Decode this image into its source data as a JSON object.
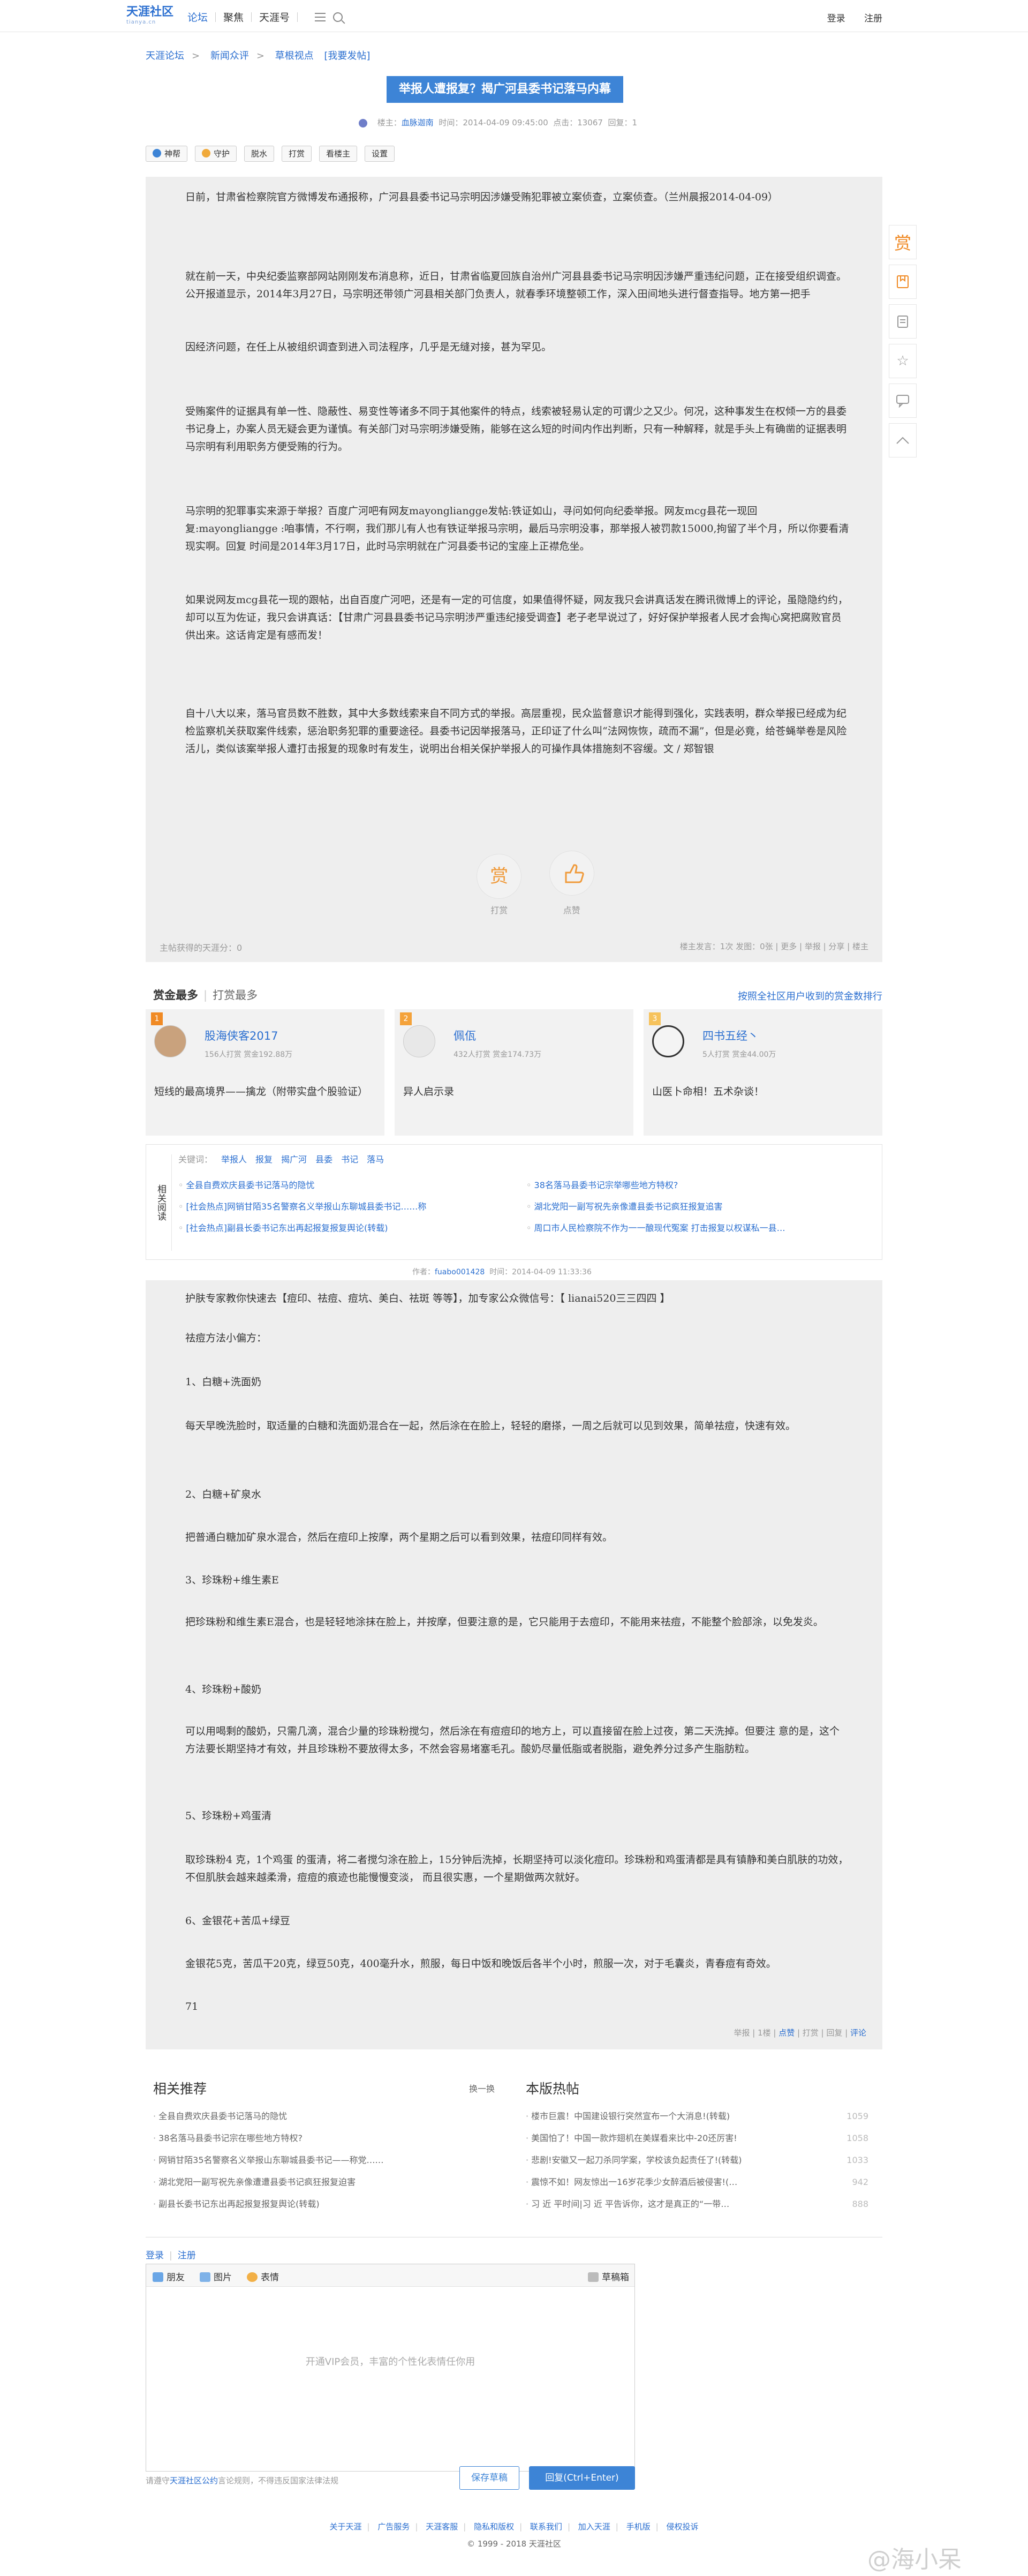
{
  "header": {
    "logo_text": "天涯社区",
    "logo_sub": "tianya.cn",
    "nav": [
      "论坛",
      "聚焦",
      "天涯号"
    ],
    "login": "登录",
    "register": "注册"
  },
  "breadcrumb": [
    "天涯论坛",
    "新闻众评",
    "草根视点",
    "[我要发帖]"
  ],
  "post": {
    "title": "举报人遭报复？揭广河县委书记落马内幕",
    "author_label": "楼主：",
    "author": "血脉迦南",
    "time": "时间：2014-04-09 09:45:00",
    "views": "点击：13067",
    "replies": "回复：1",
    "tools": [
      "神帮",
      "守护",
      "脱水",
      "打赏",
      "看楼主",
      "设置"
    ],
    "paragraphs": [
      "日前，甘肃省检察院官方微博发布通报称，广河县县委书记马宗明因涉嫌受贿犯罪被立案侦查，立案侦查。（兰州晨报2014-04-09）",
      "就在前一天，中央纪委监察部网站刚刚发布消息称，近日，甘肃省临夏回族自治州广河县县委书记马宗明因涉嫌严重违纪问题，正在接受组织调查。公开报道显示，2014年3月27日，马宗明还带领广河县相关部门负责人，就春季环境整顿工作，深入田间地头进行督查指导。地方第一把手",
      "因经济问题，在任上从被组织调查到进入司法程序，几乎是无缝对接，甚为罕见。",
      "受贿案件的证据具有单一性、隐蔽性、易变性等诸多不同于其他案件的特点，线索被轻易认定的可谓少之又少。何况，这种事发生在权倾一方的县委书记身上，办案人员无疑会更为谨慎。有关部门对马宗明涉嫌受贿，能够在这么短的时间内作出判断，只有一种解释，就是手头上有确凿的证据表明马宗明有利用职务方便受贿的行为。",
      "马宗明的犯罪事实来源于举报？百度广河吧有网友mayongliangge发帖:铁证如山，寻问如何向纪委举报。网友mcg县花一现回复:mayongliangge :咱事情，不行啊，我们那儿有人也有铁证举报马宗明，最后马宗明没事，那举报人被罚款15000,拘留了半个月，所以你要看清现实啊。回复 时间是2014年3月17日，此时马宗明就在广河县委书记的宝座上正襟危坐。",
      "如果说网友mcg县花一现的跟帖，出自百度广河吧，还是有一定的可信度，如果值得怀疑，网友我只会讲真话发在腾讯微博上的评论，虽隐隐约约，却可以互为佐证，我只会讲真话：【甘肃广河县县委书记马宗明涉严重违纪接受调查】老子老早说过了，好好保护举报者人民才会掏心窝把腐败官员供出来。这话肯定是有感而发！",
      "自十八大以来，落马官员数不胜数，其中大多数线索来自不同方式的举报。高层重视，民众监督意识才能得到强化，实践表明，群众举报已经成为纪检监察机关获取案件线索，惩治职务犯罪的重要途径。县委书记因举报落马，正印证了什么叫“法网恢恢，疏而不漏”，但是必竟，给苍蝇举卷是风险活儿，类似该案举报人遭打击报复的现象时有发生，说明出台相关保护举报人的可操作具体措施刻不容缓。文 / 郑智银"
    ],
    "reward_label": "打赏",
    "like_label": "点赞",
    "reward_score": "主帖获得的天涯分：0",
    "foot_actions": "楼主发言：1次  发图：0张 | 更多 | 举报 | 分享 | 楼主"
  },
  "sidebar_icons": [
    "赏",
    "收藏",
    "日历",
    "收藏星",
    "评论",
    "返回顶部"
  ],
  "rewards": {
    "tab_active": "赏金最多",
    "tab_other": "打赏最多",
    "rank_link": "按照全社区用户收到的赏金数排行",
    "cards": [
      {
        "rank": "1",
        "name": "股海侠客2017",
        "sub": "156人打赏  赏金192.88万",
        "desc": "短线的最高境界——擒龙（附带实盘个股验证）"
      },
      {
        "rank": "2",
        "name": "佩佤",
        "sub": "432人打赏  赏金174.73万",
        "desc": "异人启示录"
      },
      {
        "rank": "3",
        "name": "四书五经丶",
        "sub": "5人打赏  赏金44.00万",
        "desc": "山医卜命相！五术杂谈！"
      }
    ]
  },
  "related": {
    "label": "相关阅读",
    "keywords_label": "关键词：",
    "keywords": [
      "举报人",
      "报复",
      "揭广河",
      "县委",
      "书记",
      "落马"
    ],
    "left": [
      "全县自费欢庆县委书记落马的隐忧",
      "[社会热点]网销甘陌35名警察名义举报山东聊城县委书记……称",
      "[社会热点]副县长委书记东出再起报复报复舆论(转载)"
    ],
    "right": [
      "38名落马县委书记宗举哪些地方特权?",
      "湖北党阳一副写祝先亲像遭县委书记疯狂报复追害",
      "周口市人民检察院不作为一一酿现代冤案 打击报复以权谋私一县…"
    ]
  },
  "reply": {
    "author": "fuabo001428",
    "time": "时间：2014-04-09 11:33:36",
    "paragraphs": [
      "护肤专家教你快速去【痘印、祛痘、痘坑、美白、祛斑 等等】，加专家公众微信号：【 lianai520三三四四 】",
      "祛痘方法小偏方：",
      "1、白糖+洗面奶",
      "每天早晚洗脸时，取适量的白糖和洗面奶混合在一起，然后涂在在脸上，轻轻的磨搽，一周之后就可以见到效果，简单祛痘，快速有效。",
      "2、白糖+矿泉水",
      "把普通白糖加矿泉水混合，然后在痘印上按摩，两个星期之后可以看到效果，祛痘印同样有效。",
      "3、珍珠粉+维生素E",
      "把珍珠粉和维生素E混合，也是轻轻地涂抹在脸上，并按摩，但要注意的是，它只能用于去痘印，不能用来祛痘，不能整个脸部涂，以免发炎。",
      "4、珍珠粉+酸奶",
      "可以用喝剩的酸奶，只需几滴，混合少量的珍珠粉搅匀，然后涂在有痘痘印的地方上，可以直接留在脸上过夜，第二天洗掉。但要注 意的是，这个方法要长期坚持才有效，并且珍珠粉不要放得太多，不然会容易堵塞毛孔。酸奶尽量低脂或者脱脂，避免养分过多产生脂肪粒。",
      "5、珍珠粉+鸡蛋清",
      "取珍珠粉4 克，1个鸡蛋 的蛋清，将二者搅匀涂在脸上，15分钟后洗掉，长期坚持可以淡化痘印。珍珠粉和鸡蛋清都是具有镇静和美白肌肤的功效，不但肌肤会越来越柔滑，痘痘的痕迹也能慢慢变淡， 而且很实惠，一个星期做两次就好。",
      "6、金银花+苦瓜+绿豆",
      "金银花5克，苦瓜干20克，绿豆50克，400毫升水，煎服，每日中饭和晚饭后各半个小时，煎服一次，对于毛囊炎，青春痘有奇效。",
      "71"
    ],
    "foot_actions": "举报 | 1楼 | ",
    "foot_like": "点赞",
    "foot_tail": " | 打赏 | 回复 | ",
    "foot_comment": "评论"
  },
  "recommend": {
    "title": "相关推荐",
    "change": "换一换",
    "items": [
      "全县自费欢庆县委书记落马的隐忧",
      "38名落马县委书记宗在哪些地方特权?",
      "网销甘陌35名警察名义举报山东聊城县委书记——称党……",
      "湖北党阳一副写祝先亲像遭遭县委书记疯狂报复迫害",
      "副县长委书记东出再起报复报复舆论(转载)"
    ]
  },
  "hot": {
    "title": "本版热帖",
    "items": [
      {
        "t": "楼市巨震！中国建设银行突然宣布一个大消息!(转载)",
        "v": "1059"
      },
      {
        "t": "美国怕了！中国一款炸翅机在美媒看来比中-20还厉害!",
        "v": "1058"
      },
      {
        "t": "悲剧!安徽又一起刀杀同学案，学校该负起责任了!(转载)",
        "v": "1033"
      },
      {
        "t": "震惊不如！网友惊出一16岁花季少女醉酒后被侵害!(…",
        "v": "942"
      },
      {
        "t": "习 近 平时间|习 近 平告诉你，这才是真正的“一带…",
        "v": "888"
      }
    ]
  },
  "editor": {
    "login": "登录",
    "register": "注册",
    "toolbar": [
      "朋友",
      "图片",
      "表情"
    ],
    "draft": "草稿箱",
    "placeholder": "开通VIP会员，丰富的个性化表情任你用",
    "notice_prefix": "请遵守",
    "notice_link": "天涯社区公约",
    "notice_suffix": "言论规则，不得违反国家法律法规",
    "save": "保存草稿",
    "submit": "回复(Ctrl+Enter)"
  },
  "footer": {
    "links": [
      "关于天涯",
      "广告服务",
      "天涯客服",
      "隐私和版权",
      "联系我们",
      "加入天涯",
      "手机版",
      "侵权投诉"
    ],
    "copyright": "© 1999 - 2018 天涯社区",
    "watermark": "@海小呆"
  },
  "colors": {
    "accent": "#3d84d6",
    "reward": "#f08a24",
    "post_bg": "#eeeeee"
  }
}
